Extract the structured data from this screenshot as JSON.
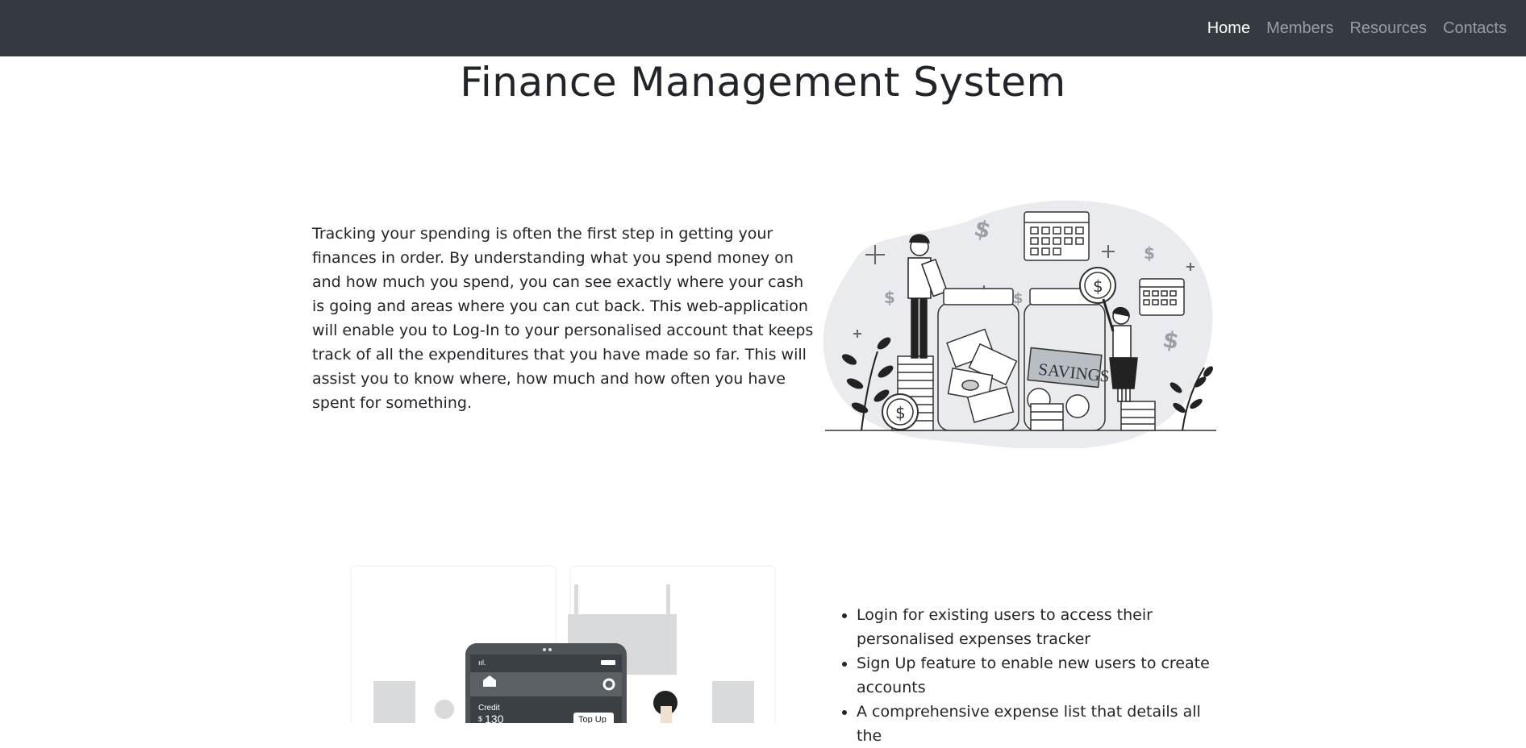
{
  "nav": {
    "links": [
      {
        "label": "Home",
        "active": true
      },
      {
        "label": "Members",
        "active": false
      },
      {
        "label": "Resources",
        "active": false
      },
      {
        "label": "Contacts",
        "active": false
      }
    ]
  },
  "page": {
    "title": "Finance Management System",
    "intro": "Tracking your spending is often the first step in getting your finances in order. By understanding what you spend money on and how much you spend, you can see exactly where your cash is going and areas where you can cut back. This web-application will enable you to Log-In to your personalised account that keeps track of all the expenditures that you have made so far. This will assist you to know where, how much and how often you have spent for something."
  },
  "illustration": {
    "jar_label": "SAVINGS",
    "phone_credit_label": "Credit",
    "phone_credit_currency": "$",
    "phone_credit_value": "130",
    "phone_topup_label": "Top Up"
  },
  "features": [
    "Login for existing users to access their personalised expenses tracker",
    "Sign Up feature to enable new users to create accounts",
    "A comprehensive expense list that details all the"
  ],
  "colors": {
    "navbar_bg": "#343a40",
    "nav_active": "#ffffff",
    "nav_inactive": "#9a9da1",
    "text": "#212529",
    "illustration_blob": "#e9ebee"
  }
}
